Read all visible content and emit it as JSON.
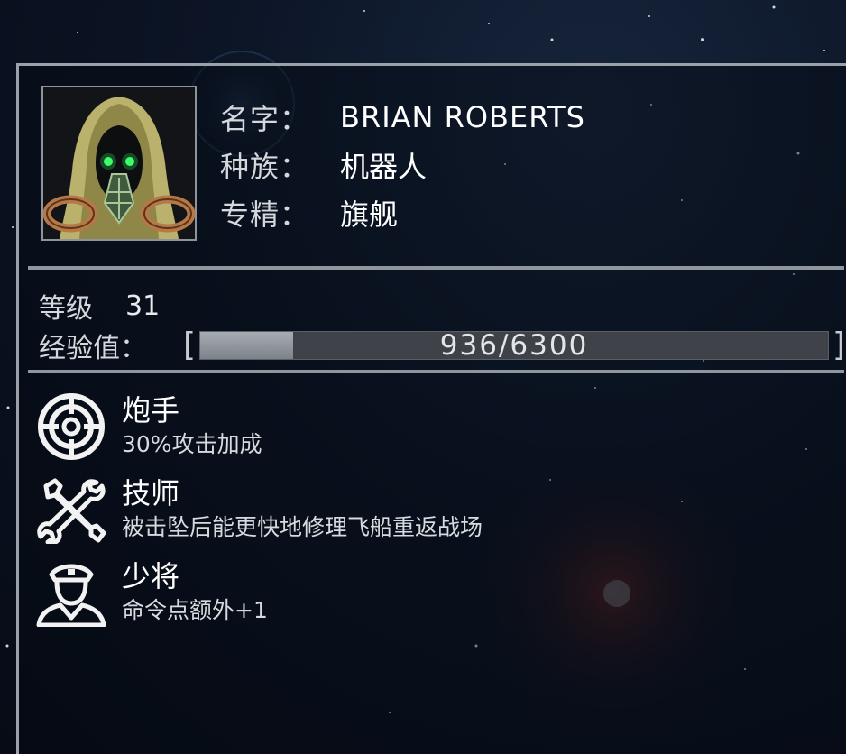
{
  "profile": {
    "name_label": "名字：",
    "name_value": "BRIAN ROBERTS",
    "race_label": "种族：",
    "race_value": "机器人",
    "specialty_label": "专精：",
    "specialty_value": "旗舰"
  },
  "stats": {
    "level_label": "等级",
    "level_value": "31",
    "xp_label": "经验值：",
    "xp_current": 936,
    "xp_max": 6300,
    "xp_text": "936/6300"
  },
  "skills": [
    {
      "icon": "crosshair-icon",
      "title": "炮手",
      "desc": "30%攻击加成"
    },
    {
      "icon": "wrench-screwdriver-icon",
      "title": "技师",
      "desc": "被击坠后能更快地修理飞船重返战场"
    },
    {
      "icon": "officer-icon",
      "title": "少将",
      "desc": "命令点额外+1"
    }
  ],
  "colors": {
    "panel_border": "#9aa1a9",
    "xp_fill": "#8c9198",
    "xp_track": "#3f4349",
    "portrait_hood": "#c7c07a",
    "portrait_eyes": "#3cff6a"
  }
}
